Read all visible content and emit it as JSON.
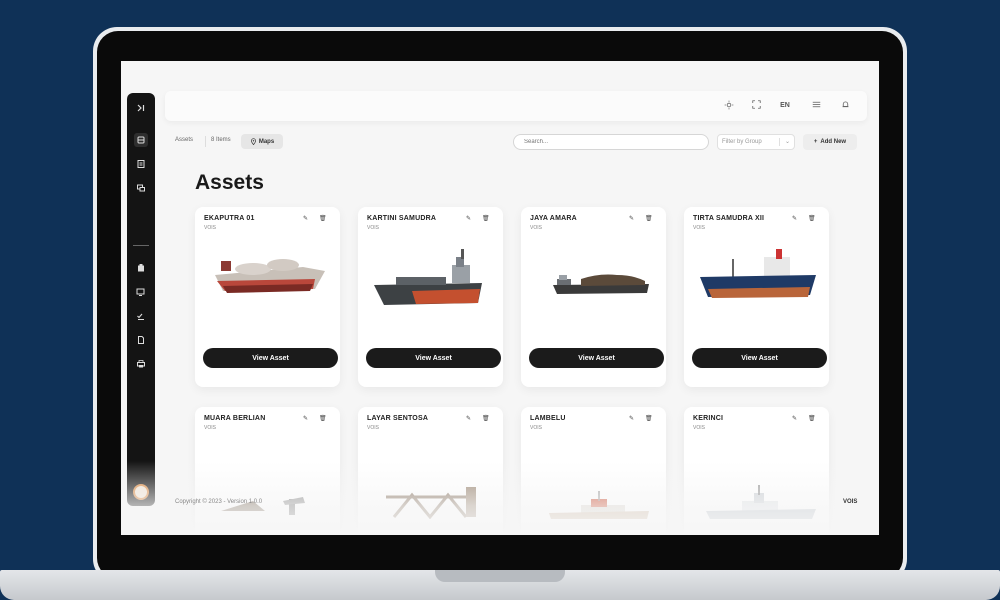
{
  "topbar": {
    "language": "EN"
  },
  "toolbar": {
    "breadcrumb": "Assets",
    "item_count": "8 Items",
    "maps_label": "Maps",
    "search_placeholder": "Search...",
    "filter_placeholder": "Filter by Group",
    "add_new_label": "Add New"
  },
  "page": {
    "title": "Assets"
  },
  "cards": [
    {
      "name": "EKAPUTRA 01",
      "group": "VOIS",
      "button": "View Asset"
    },
    {
      "name": "KARTINI SAMUDRA",
      "group": "VOIS",
      "button": "View Asset"
    },
    {
      "name": "JAYA AMARA",
      "group": "VOIS",
      "button": "View Asset"
    },
    {
      "name": "TIRTA SAMUDRA XII",
      "group": "VOIS",
      "button": "View Asset"
    },
    {
      "name": "MUARA BERLIAN",
      "group": "VOIS"
    },
    {
      "name": "LAYAR SENTOSA",
      "group": "VOIS"
    },
    {
      "name": "LAMBELU",
      "group": "VOIS"
    },
    {
      "name": "KERINCI",
      "group": "VOIS"
    }
  ],
  "footer": {
    "copyright": "Copyright © 2023 - Version 1.0.0",
    "right_text": "VOIS"
  },
  "icons": [
    "sidebar-expand-icon",
    "assets-icon",
    "documents-icon",
    "chat-icon",
    "building-icon",
    "screen-icon",
    "checklist-icon",
    "report-icon",
    "print-icon",
    "sun-icon",
    "fullscreen-icon",
    "list-icon",
    "bell-icon",
    "map-pin-icon",
    "plus-icon",
    "edit-icon",
    "trash-icon"
  ]
}
